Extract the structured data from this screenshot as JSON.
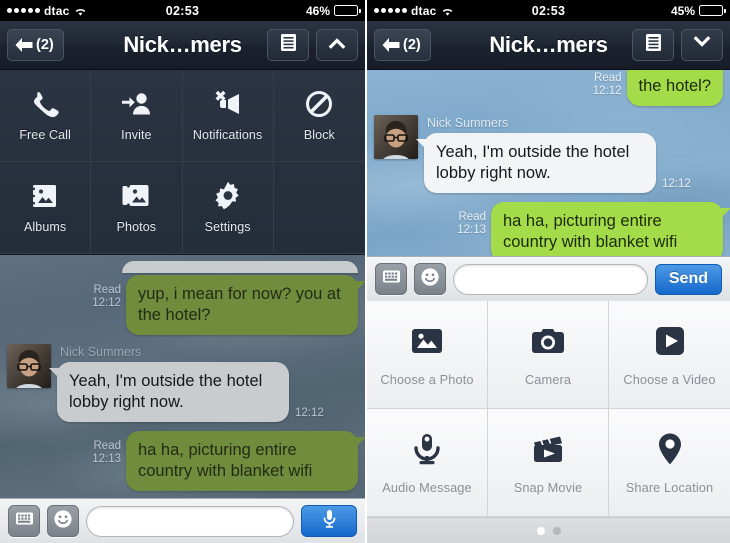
{
  "left": {
    "status": {
      "carrier": "dtac",
      "signal_dots": 5,
      "wifi_icon": "wifi-icon",
      "time": "02:53",
      "battery_text": "46%",
      "battery_level": 46
    },
    "nav": {
      "back_label": "(2)",
      "back_icon": "arrow-left-icon",
      "title": "Nick…mers",
      "menu_icon": "list-menu-icon",
      "toggle_icon": "chevron-up-icon"
    },
    "menu": {
      "items": [
        {
          "label": "Free Call",
          "icon": "phone-icon"
        },
        {
          "label": "Invite",
          "icon": "add-person-icon"
        },
        {
          "label": "Notifications",
          "icon": "mute-megaphone-icon"
        },
        {
          "label": "Block",
          "icon": "block-icon"
        },
        {
          "label": "Albums",
          "icon": "album-icon"
        },
        {
          "label": "Photos",
          "icon": "photos-icon"
        },
        {
          "label": "Settings",
          "icon": "gear-icon"
        }
      ]
    },
    "chat": {
      "messages": [
        {
          "direction": "out",
          "text": "yup, i mean for now? you at the hotel?",
          "status": "Read",
          "time": "12:12"
        },
        {
          "direction": "in",
          "sender": "Nick Summers",
          "text": "Yeah, I'm outside the hotel lobby right now.",
          "time": "12:12",
          "avatar": "contact-avatar"
        },
        {
          "direction": "out",
          "text": "ha ha, picturing entire country with blanket wifi",
          "status": "Read",
          "time": "12:13"
        }
      ]
    },
    "input": {
      "keyboard_icon": "keyboard-icon",
      "sticker_icon": "smiley-icon",
      "field_value": "",
      "field_placeholder": "",
      "action_icon": "microphone-icon"
    }
  },
  "right": {
    "status": {
      "carrier": "dtac",
      "signal_dots": 5,
      "wifi_icon": "wifi-icon",
      "time": "02:53",
      "battery_text": "45%",
      "battery_level": 45
    },
    "nav": {
      "back_label": "(2)",
      "back_icon": "arrow-left-icon",
      "title": "Nick…mers",
      "menu_icon": "list-menu-icon",
      "toggle_icon": "chevron-down-icon"
    },
    "chat": {
      "messages": [
        {
          "direction": "out",
          "text": "the hotel?",
          "status": "Read",
          "time": "12:12",
          "partial": true
        },
        {
          "direction": "in",
          "sender": "Nick Summers",
          "text": "Yeah, I'm outside the hotel lobby right now.",
          "time": "12:12",
          "avatar": "contact-avatar"
        },
        {
          "direction": "out",
          "text": "ha ha, picturing entire country with blanket wifi",
          "status": "Read",
          "time": "12:13"
        }
      ]
    },
    "input": {
      "keyboard_icon": "keyboard-icon",
      "sticker_icon": "smiley-icon",
      "field_value": "",
      "field_placeholder": "",
      "send_label": "Send"
    },
    "attachments": {
      "items": [
        {
          "label": "Choose a Photo",
          "icon": "photo-icon"
        },
        {
          "label": "Camera",
          "icon": "camera-icon"
        },
        {
          "label": "Choose a Video",
          "icon": "video-play-icon"
        },
        {
          "label": "Audio Message",
          "icon": "microphone-icon"
        },
        {
          "label": "Snap Movie",
          "icon": "clapperboard-icon"
        },
        {
          "label": "Share Location",
          "icon": "map-pin-icon"
        }
      ],
      "page_count": 2,
      "active_page": 1
    }
  },
  "colors": {
    "accent_blue": "#1668cc",
    "bubble_green_bright": "#a3dc48",
    "bubble_green_dim": "#6f8d3c",
    "bubble_gray_bright": "#f2f4f5",
    "bubble_gray_dim": "#c8ccce",
    "navbar_dark": "#1f2734",
    "menu_panel": "#2b3442"
  }
}
